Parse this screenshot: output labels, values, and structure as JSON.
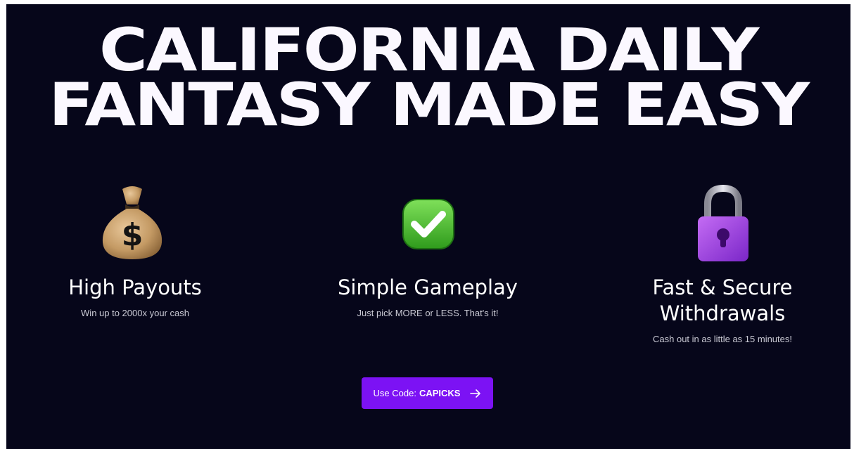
{
  "headline": {
    "line1": "CALIFORNIA DAILY",
    "line2": "FANTASY MADE EASY"
  },
  "features": [
    {
      "icon": "money-bag-icon",
      "title": "High Payouts",
      "subtitle": "Win up to 2000x your cash"
    },
    {
      "icon": "check-mark-icon",
      "title": "Simple Gameplay",
      "subtitle": "Just pick MORE or LESS. That's it!"
    },
    {
      "icon": "padlock-icon",
      "title_line1": "Fast & Secure",
      "title_line2": "Withdrawals",
      "subtitle": "Cash out in as little as 15 minutes!"
    }
  ],
  "cta": {
    "prefix": "Use Code:",
    "code": "CAPICKS",
    "icon": "arrow-right-icon"
  },
  "colors": {
    "background": "#06061a",
    "text": "#ffffff",
    "accent": "#7c12f4"
  }
}
